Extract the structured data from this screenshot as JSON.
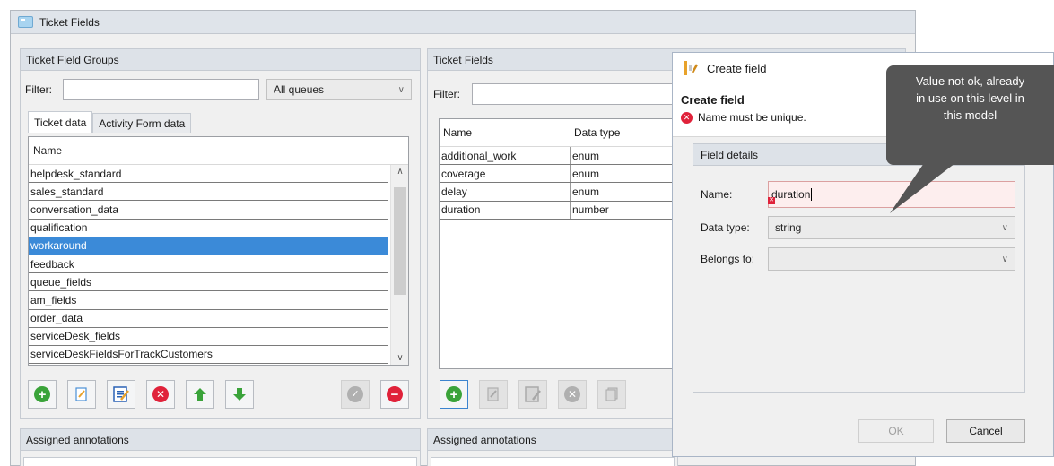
{
  "window": {
    "title": "Ticket Fields"
  },
  "groups_panel": {
    "title": "Ticket Field Groups",
    "filter_label": "Filter:",
    "filter_value": "",
    "queue_select": "All queues",
    "tabs": [
      "Ticket data",
      "Activity Form data"
    ],
    "column_header": "Name",
    "items": [
      "helpdesk_standard",
      "sales_standard",
      "conversation_data",
      "qualification",
      "workaround",
      "feedback",
      "queue_fields",
      "am_fields",
      "order_data",
      "serviceDesk_fields",
      "serviceDeskFieldsForTrackCustomers"
    ],
    "selected_item": "workaround"
  },
  "fields_panel": {
    "title": "Ticket Fields",
    "filter_label": "Filter:",
    "filter_value": "",
    "columns": [
      "Name",
      "Data type"
    ],
    "rows": [
      [
        "additional_work",
        "enum"
      ],
      [
        "coverage",
        "enum"
      ],
      [
        "delay",
        "enum"
      ],
      [
        "duration",
        "number"
      ]
    ]
  },
  "annotations_left": {
    "title": "Assigned annotations"
  },
  "annotations_right": {
    "title": "Assigned annotations"
  },
  "dialog": {
    "title": "Create field",
    "heading": "Create field",
    "error_message": "Name must be unique.",
    "field_details_title": "Field details",
    "name_label": "Name:",
    "name_value": "duration",
    "data_type_label": "Data type:",
    "data_type_value": "string",
    "belongs_to_label": "Belongs to:",
    "belongs_to_value": "",
    "ok_label": "OK",
    "cancel_label": "Cancel"
  },
  "tooltip": {
    "line1": "Value not ok, already",
    "line2": "in use on this level in",
    "line3": "this model"
  },
  "colors": {
    "selection": "#3b8ad8",
    "error": "#e0223a",
    "add": "#3aa33a",
    "tooltip_bg": "#555555"
  }
}
